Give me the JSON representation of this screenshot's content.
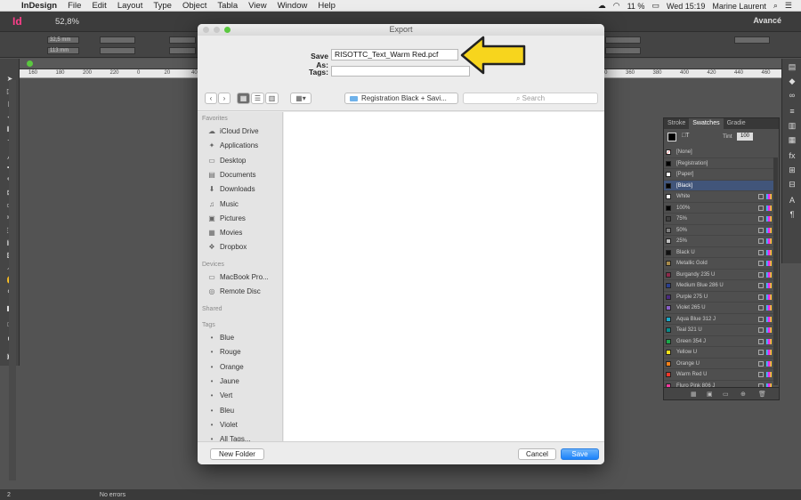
{
  "menubar": {
    "items": [
      "InDesign",
      "File",
      "Edit",
      "Layout",
      "Type",
      "Object",
      "Tabla",
      "View",
      "Window",
      "Help"
    ],
    "battery": "11 %",
    "clock": "Wed 15:19",
    "user": "Marine Laurent"
  },
  "appbar": {
    "zoom": "52,8%",
    "workspace": "Avancé"
  },
  "control": {
    "x": "32,5 mm",
    "y": "113 mm"
  },
  "ruler": [
    "160",
    "180",
    "200",
    "220",
    "0",
    "20",
    "40",
    "60",
    "80",
    "100",
    "120",
    "140",
    "160",
    "180",
    "200",
    "220",
    "240",
    "260",
    "280",
    "300",
    "320",
    "340",
    "360",
    "380",
    "400",
    "420",
    "440",
    "460"
  ],
  "dialog": {
    "title": "Export",
    "save_as_label": "Save As:",
    "filename": "RISOTTC_Text_Warm Red.pcf",
    "tags_label": "Tags:",
    "location": "Registration Black + Savi...",
    "search_placeholder": "Search",
    "sidebar": {
      "favorites_label": "Favorites",
      "favorites": [
        {
          "label": "iCloud Drive",
          "icon": "cloud-icon"
        },
        {
          "label": "Applications",
          "icon": "applications-icon"
        },
        {
          "label": "Desktop",
          "icon": "desktop-icon"
        },
        {
          "label": "Documents",
          "icon": "documents-icon"
        },
        {
          "label": "Downloads",
          "icon": "downloads-icon"
        },
        {
          "label": "Music",
          "icon": "music-icon"
        },
        {
          "label": "Pictures",
          "icon": "pictures-icon"
        },
        {
          "label": "Movies",
          "icon": "movies-icon"
        },
        {
          "label": "Dropbox",
          "icon": "dropbox-icon"
        }
      ],
      "devices_label": "Devices",
      "devices": [
        {
          "label": "MacBook Pro...",
          "icon": "laptop-icon"
        },
        {
          "label": "Remote Disc",
          "icon": "disc-icon"
        }
      ],
      "shared_label": "Shared",
      "tags_label": "Tags",
      "tags": [
        {
          "label": "Blue",
          "color": "#3b9cf0"
        },
        {
          "label": "Rouge",
          "color": "#f0534d"
        },
        {
          "label": "Orange",
          "color": "#f5a033"
        },
        {
          "label": "Jaune",
          "color": "#f4cf3a"
        },
        {
          "label": "Vert",
          "color": "#53c449"
        },
        {
          "label": "Bleu",
          "color": "#3b9cf0"
        },
        {
          "label": "Violet",
          "color": "#bd7bdb"
        },
        {
          "label": "All Tags...",
          "color": "#c7c7c7"
        }
      ]
    },
    "new_folder": "New Folder",
    "cancel": "Cancel",
    "save": "Save"
  },
  "swatches_panel": {
    "tabs": [
      "Stroke",
      "Swatches",
      "Gradie"
    ],
    "tint_label": "Tint",
    "tint": "100",
    "swatches": [
      {
        "name": "[None]",
        "color": "#ffffff"
      },
      {
        "name": "[Registration]",
        "color": "#000000"
      },
      {
        "name": "[Paper]",
        "color": "#ffffff"
      },
      {
        "name": "[Black]",
        "color": "#000000"
      },
      {
        "name": "White",
        "color": "#ffffff"
      },
      {
        "name": "100%",
        "color": "#000000"
      },
      {
        "name": "75%",
        "color": "#404040"
      },
      {
        "name": "50%",
        "color": "#808080"
      },
      {
        "name": "25%",
        "color": "#bfbfbf"
      },
      {
        "name": "Black U",
        "color": "#111111"
      },
      {
        "name": "Metallic Gold",
        "color": "#a88b4a"
      },
      {
        "name": "Burgandy 235 U",
        "color": "#8c2a4a"
      },
      {
        "name": "Medium Blue 286 U",
        "color": "#2a3f8f"
      },
      {
        "name": "Purple 275 U",
        "color": "#4a2a7f"
      },
      {
        "name": "Violet 265 U",
        "color": "#8a60c8"
      },
      {
        "name": "Aqua Blue 312 J",
        "color": "#1aa8c8"
      },
      {
        "name": "Teal 321 U",
        "color": "#0a8a8a"
      },
      {
        "name": "Green 354 J",
        "color": "#1aa84a"
      },
      {
        "name": "Yellow U",
        "color": "#f5e21a"
      },
      {
        "name": "Orange U",
        "color": "#f5821a"
      },
      {
        "name": "Warm Red U",
        "color": "#f0382a"
      },
      {
        "name": "Fluro Pink 806 J",
        "color": "#f53aa0"
      }
    ]
  },
  "status": {
    "page": "2",
    "errors": "No errors"
  }
}
